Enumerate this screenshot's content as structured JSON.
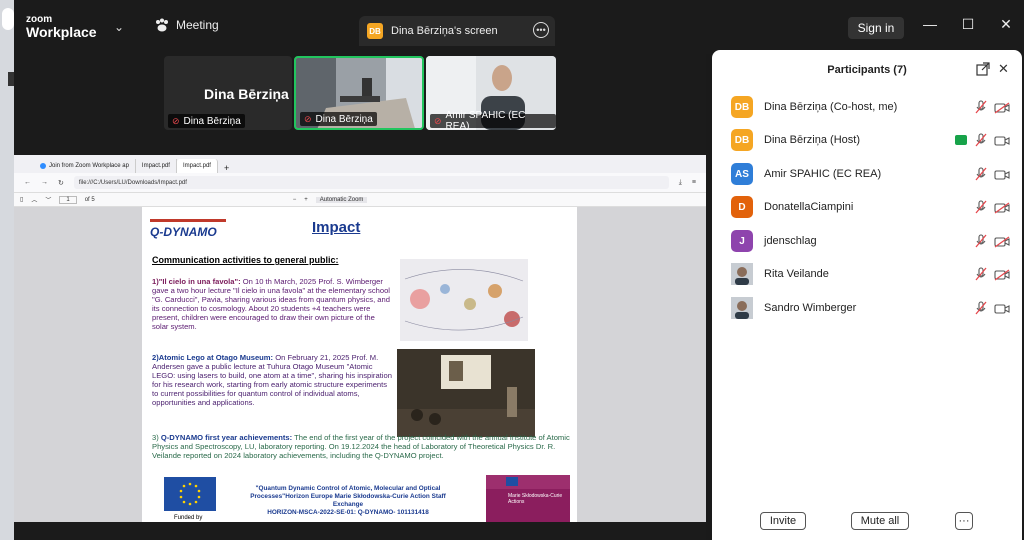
{
  "app": {
    "logo_line1": "zoom",
    "logo_line2": "Workplace"
  },
  "titlebar": {
    "meeting_label": "Meeting",
    "share_tab_badge": "DB",
    "share_tab_label": "Dina Bērziņa's screen",
    "signin_label": "Sign in"
  },
  "videos": {
    "tile1_big_name": "Dina Bērziņa",
    "tile1_tag": "Dina Bērziņa",
    "tile2_tag": "Dina Bērziņa",
    "tile3_tag": "Amir SPAHIC (EC REA)"
  },
  "browser": {
    "tabs": [
      "Join from Zoom Workplace ap",
      "Impact.pdf",
      "Impact.pdf"
    ],
    "new_tab": "+",
    "url": "file:///C:/Users/LU/Downloads/Impact.pdf",
    "page_num": "1",
    "page_total": "of 5",
    "zoom": "Automatic Zoom"
  },
  "pdf": {
    "logo": "Q-DYNAMO",
    "title": "Impact",
    "section_heading": "Communication activities to general public:",
    "item1_head": "1)\"Il cielo in una favola\":",
    "item1_body": " On 10 th March, 2025 Prof. S. Wimberger gave a two hour lecture \"Il cielo in una favola\" at the elementary school \"G. Carducci\", Pavia, sharing various ideas from quantum physics, and its connection to cosmology. About 20 students +4 teachers were present, children were encouraged to draw their own picture of the solar system.",
    "item2_head": "2)Atomic Lego at Otago Museum:",
    "item2_body": " On February 21, 2025  Prof. M. Andersen gave a public lecture at Tuhura Otago Museum \"Atomic LEGO: using lasers to build, one atom at a time\", sharing  his inspiration for his research work, starting from early atomic  structure experiments to current possibilities for quantum control of individual atoms, opportunities and applications.",
    "item3_prefix": "3) ",
    "item3_head": "Q-DYNAMO first year achievements:",
    "item3_body": " The end of the first year of the project coincided with the annual Institute of Atomic Physics and Spectroscopy, LU, laboratory reporting. On 19.12.2024 the head of Laboratory of Theoretical Physics Dr. R. Veilande reported on 2024 laboratory achievements, including the Q-DYNAMO project.",
    "funded_by": "Funded by",
    "footer_line1": "\"Quantum Dynamic Control of Atomic, Molecular and Optical Processes\"Horizon Europe Marie Skłodowska-Curie Action Staff Exchange",
    "footer_line2": "HORIZON-MSCA-2022-SE-01: Q-DYNAMO- 101131418",
    "msca_text": "Marie Skłodowska-Curie Actions"
  },
  "participants": {
    "title": "Participants (7)",
    "list": [
      {
        "initials": "DB",
        "name": "Dina Bērziņa (Co-host, me)",
        "color": "#f5a623"
      },
      {
        "initials": "DB",
        "name": "Dina Bērziņa (Host)",
        "color": "#f5a623"
      },
      {
        "initials": "AS",
        "name": "Amir SPAHIC (EC REA)",
        "color": "#2f7ed8"
      },
      {
        "initials": "D",
        "name": "DonatellaCiampini",
        "color": "#e2620b"
      },
      {
        "initials": "J",
        "name": "jdenschlag",
        "color": "#8e44ad"
      },
      {
        "initials": "",
        "name": "Rita Veilande",
        "color": "#7a8c9a"
      },
      {
        "initials": "",
        "name": "Sandro Wimberger",
        "color": "#556070"
      }
    ],
    "invite_label": "Invite",
    "mute_all_label": "Mute all",
    "more_label": "···"
  }
}
